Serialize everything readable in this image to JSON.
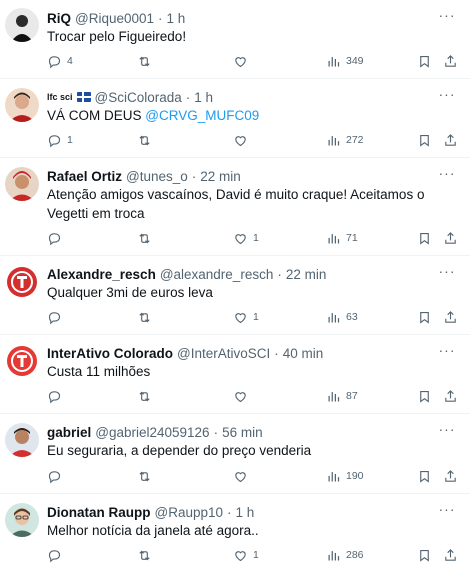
{
  "colors": {
    "text": "#0f1419",
    "muted": "#536471",
    "link": "#1d9bf0",
    "divider": "#eff3f4"
  },
  "tweets": [
    {
      "name": "RiQ",
      "handle": "@Rique0001",
      "dot": "·",
      "time": "1 h",
      "text": "Trocar pelo Figueiredo!",
      "replies": "4",
      "retweets": "",
      "likes": "",
      "views": "349",
      "avatar_icon": "person-avatar"
    },
    {
      "name": "lfc sci",
      "handle": "@SciColorada",
      "dot": "·",
      "time": "1 h",
      "text": "VÁ COM DEUS ",
      "mention": "@CRVG_MUFC09",
      "replies": "1",
      "retweets": "",
      "likes": "",
      "views": "272",
      "avatar_icon": "person-avatar",
      "flag_icon": "flag-icon"
    },
    {
      "name": "Rafael Ortiz",
      "handle": "@tunes_o",
      "dot": "·",
      "time": "22 min",
      "text": "Atenção amigos vascaínos, David é muito craque! Aceitamos o Vegetti em troca",
      "replies": "",
      "retweets": "",
      "likes": "1",
      "views": "71",
      "avatar_icon": "person-avatar"
    },
    {
      "name": "Alexandre_resch",
      "handle": "@alexandre_resch",
      "dot": "·",
      "time": "22 min",
      "text": "Qualquer 3mi de euros leva",
      "replies": "",
      "retweets": "",
      "likes": "1",
      "views": "63",
      "avatar_icon": "club-crest-avatar"
    },
    {
      "name": "InterAtivo Colorado",
      "handle": "@InterAtivoSCI",
      "dot": "·",
      "time": "40 min",
      "text": "Custa 11 milhões",
      "replies": "",
      "retweets": "",
      "likes": "",
      "views": "87",
      "avatar_icon": "club-crest-avatar"
    },
    {
      "name": "gabriel",
      "handle": "@gabriel24059126",
      "dot": "·",
      "time": "56 min",
      "text": "Eu seguraria, a depender do preço venderia",
      "replies": "",
      "retweets": "",
      "likes": "",
      "views": "190",
      "avatar_icon": "person-avatar"
    },
    {
      "name": "Dionatan Raupp",
      "handle": "@Raupp10",
      "dot": "·",
      "time": "1 h",
      "text": "Melhor notícia da janela até agora..",
      "replies": "",
      "retweets": "",
      "likes": "1",
      "views": "286",
      "avatar_icon": "person-avatar"
    }
  ]
}
